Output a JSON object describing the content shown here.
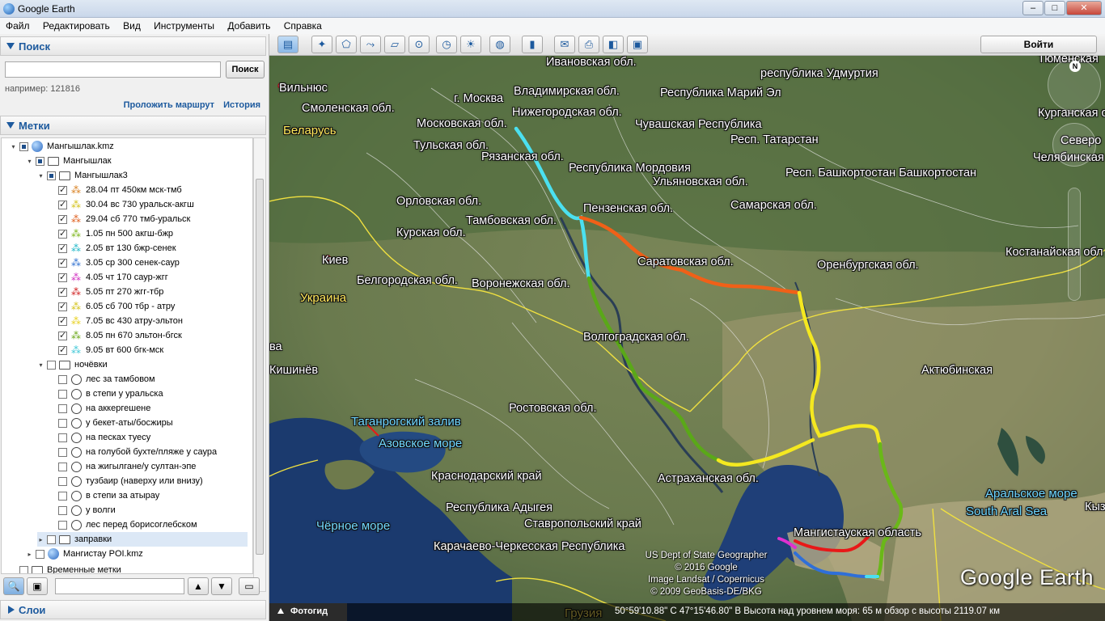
{
  "window": {
    "title": "Google Earth",
    "minimize": "–",
    "maximize": "□",
    "close": "✕"
  },
  "menu": [
    "Файл",
    "Редактировать",
    "Вид",
    "Инструменты",
    "Добавить",
    "Справка"
  ],
  "search": {
    "header": "Поиск",
    "button": "Поиск",
    "input_value": "",
    "hint": "например: 121816",
    "route_link": "Проложить маршрут",
    "history_link": "История"
  },
  "places": {
    "header": "Метки",
    "items": [
      {
        "label": "Мангышлак.kmz",
        "icon": "globe-icon",
        "level": 0
      },
      {
        "label": "Мангышлак",
        "icon": "folder-open-icon",
        "level": 1
      },
      {
        "label": "Мангышлак3",
        "icon": "folder-open-icon",
        "level": 2
      },
      {
        "label": "28.04 пт 450км мск-тмб",
        "icon": "path-icon",
        "color": "#d98020",
        "level": 3
      },
      {
        "label": "30.04 вс 730 уральск-акгш",
        "icon": "path-icon",
        "color": "#d4c21a",
        "level": 3
      },
      {
        "label": "29.04 сб 770 тмб-уральск",
        "icon": "path-icon",
        "color": "#e06020",
        "level": 3
      },
      {
        "label": "1.05 пн 500 акгш-бжр",
        "icon": "path-icon",
        "color": "#7cb518",
        "level": 3
      },
      {
        "label": "2.05 вт 130 бжр-сенек",
        "icon": "path-icon",
        "color": "#21b8c8",
        "level": 3
      },
      {
        "label": "3.05 ср 300 сенек-саур",
        "icon": "path-icon",
        "color": "#2e6fd0",
        "level": 3
      },
      {
        "label": "4.05 чт 170 саур-жгг",
        "icon": "path-icon",
        "color": "#d030c0",
        "level": 3
      },
      {
        "label": "5.05 пт 270 жгг-тбр",
        "icon": "path-icon",
        "color": "#d02020",
        "level": 3
      },
      {
        "label": "6.05 сб 700 тбр - атру",
        "icon": "path-icon",
        "color": "#d4c21a",
        "level": 3
      },
      {
        "label": "7.05 вс 430 атру-эльтон",
        "icon": "path-icon",
        "color": "#e8d020",
        "level": 3
      },
      {
        "label": "8.05 пн 670 эльтон-бгск",
        "icon": "path-icon",
        "color": "#6aa818",
        "level": 3
      },
      {
        "label": "9.05 вт 600 бгк-мск",
        "icon": "path-icon",
        "color": "#40c8d8",
        "level": 3
      },
      {
        "label": "ночёвки",
        "icon": "folder-open-icon",
        "level": 2
      },
      {
        "label": "лес за тамбовом",
        "icon": "circle-icon",
        "level": 3
      },
      {
        "label": "в степи у уральска",
        "icon": "circle-icon",
        "level": 3
      },
      {
        "label": "на аккергешене",
        "icon": "circle-icon",
        "level": 3
      },
      {
        "label": "у бекет-аты/босжиры",
        "icon": "circle-icon",
        "level": 3
      },
      {
        "label": "на песках туесу",
        "icon": "circle-icon",
        "level": 3
      },
      {
        "label": "на голубой бухте/пляже у саура",
        "icon": "circle-icon",
        "level": 3
      },
      {
        "label": "на жигылгане/у султан-эпе",
        "icon": "circle-icon",
        "level": 3
      },
      {
        "label": "тузбаир (наверху или внизу)",
        "icon": "circle-icon",
        "level": 3
      },
      {
        "label": "в степи за атырау",
        "icon": "circle-icon",
        "level": 3
      },
      {
        "label": "у волги",
        "icon": "circle-icon",
        "level": 3
      },
      {
        "label": "лес перед борисоглебском",
        "icon": "circle-icon",
        "level": 3
      },
      {
        "label": "заправки",
        "icon": "folder-icon",
        "level": 2
      },
      {
        "label": "Мангистау POI.kmz",
        "icon": "globe-icon",
        "level": 1
      },
      {
        "label": "Временные метки",
        "icon": "folder-icon",
        "level": 0
      }
    ]
  },
  "layers": {
    "header": "Слои"
  },
  "toolbar": {
    "sign_in": "Войти"
  },
  "map": {
    "labels": [
      {
        "text": "Ивановская обл.",
        "type": "region"
      },
      {
        "text": "республика Удмуртия",
        "type": "region"
      },
      {
        "text": "Тюменская",
        "type": "region"
      },
      {
        "text": "Вильнюс",
        "type": "city"
      },
      {
        "text": "Владимирская обл.",
        "type": "region"
      },
      {
        "text": "г. Москва",
        "type": "region"
      },
      {
        "text": "Республика Марий Эл",
        "type": "region"
      },
      {
        "text": "Смоленская обл.",
        "type": "region"
      },
      {
        "text": "Нижегородская обл.",
        "type": "region"
      },
      {
        "text": "Курганская обл.",
        "type": "region"
      },
      {
        "text": "Московская обл.",
        "type": "region"
      },
      {
        "text": "Чувашская Республика",
        "type": "region"
      },
      {
        "text": "Беларусь",
        "type": "country"
      },
      {
        "text": "Респ. Татарстан",
        "type": "region"
      },
      {
        "text": "Северо",
        "type": "region"
      },
      {
        "text": "Тульская обл.",
        "type": "region"
      },
      {
        "text": "Рязанская обл.",
        "type": "region"
      },
      {
        "text": "Челябинская обл.",
        "type": "region"
      },
      {
        "text": "Республика Мордовия",
        "type": "region"
      },
      {
        "text": "Респ. Башкортостан Башкортостан",
        "type": "region"
      },
      {
        "text": "Ульяновская обл.",
        "type": "region"
      },
      {
        "text": "Орловская обл.",
        "type": "region"
      },
      {
        "text": "Самарская обл.",
        "type": "region"
      },
      {
        "text": "Пензенская обл.",
        "type": "region"
      },
      {
        "text": "Тамбовская обл.",
        "type": "region"
      },
      {
        "text": "Курская обл.",
        "type": "region"
      },
      {
        "text": "Костанайская обл",
        "type": "region"
      },
      {
        "text": "Саратовская обл.",
        "type": "region"
      },
      {
        "text": "Киев",
        "type": "city"
      },
      {
        "text": "Оренбургская обл.",
        "type": "region"
      },
      {
        "text": "Белгородская обл.",
        "type": "region"
      },
      {
        "text": "Воронежская обл.",
        "type": "region"
      },
      {
        "text": "Украина",
        "type": "country"
      },
      {
        "text": "Волгоградская обл.",
        "type": "region"
      },
      {
        "text": "ва",
        "type": "region"
      },
      {
        "text": "Кишинёв",
        "type": "city"
      },
      {
        "text": "Актюбинская",
        "type": "region"
      },
      {
        "text": "Ростовская обл.",
        "type": "region"
      },
      {
        "text": "Таганрогский залив",
        "type": "water"
      },
      {
        "text": "Азовское море",
        "type": "water"
      },
      {
        "text": "Краснодарский край",
        "type": "region"
      },
      {
        "text": "Астраханская обл.",
        "type": "region"
      },
      {
        "text": "Аральское море",
        "type": "water"
      },
      {
        "text": "South Aral Sea",
        "type": "water"
      },
      {
        "text": "Кыз",
        "type": "region"
      },
      {
        "text": "Республика Адыгея",
        "type": "region"
      },
      {
        "text": "Ставропольский край",
        "type": "region"
      },
      {
        "text": "Чёрное море",
        "type": "water"
      },
      {
        "text": "Мангистауская область",
        "type": "region"
      },
      {
        "text": "Карачаево-Черкесская Республика",
        "type": "region"
      },
      {
        "text": "Грузия",
        "type": "country"
      }
    ],
    "attribution": [
      "US Dept of State Geographer",
      "© 2016 Google",
      "Image Landsat / Copernicus",
      "© 2009 GeoBasis-DE/BKG"
    ],
    "logo": "Google Earth",
    "compass_n": "N",
    "tour_guide": "Фотогид",
    "status": "50°59'10.88\" С   47°15'46.80\" В  Высота над уровнем моря:   65 м     обзор с высоты 2119.07 км"
  }
}
